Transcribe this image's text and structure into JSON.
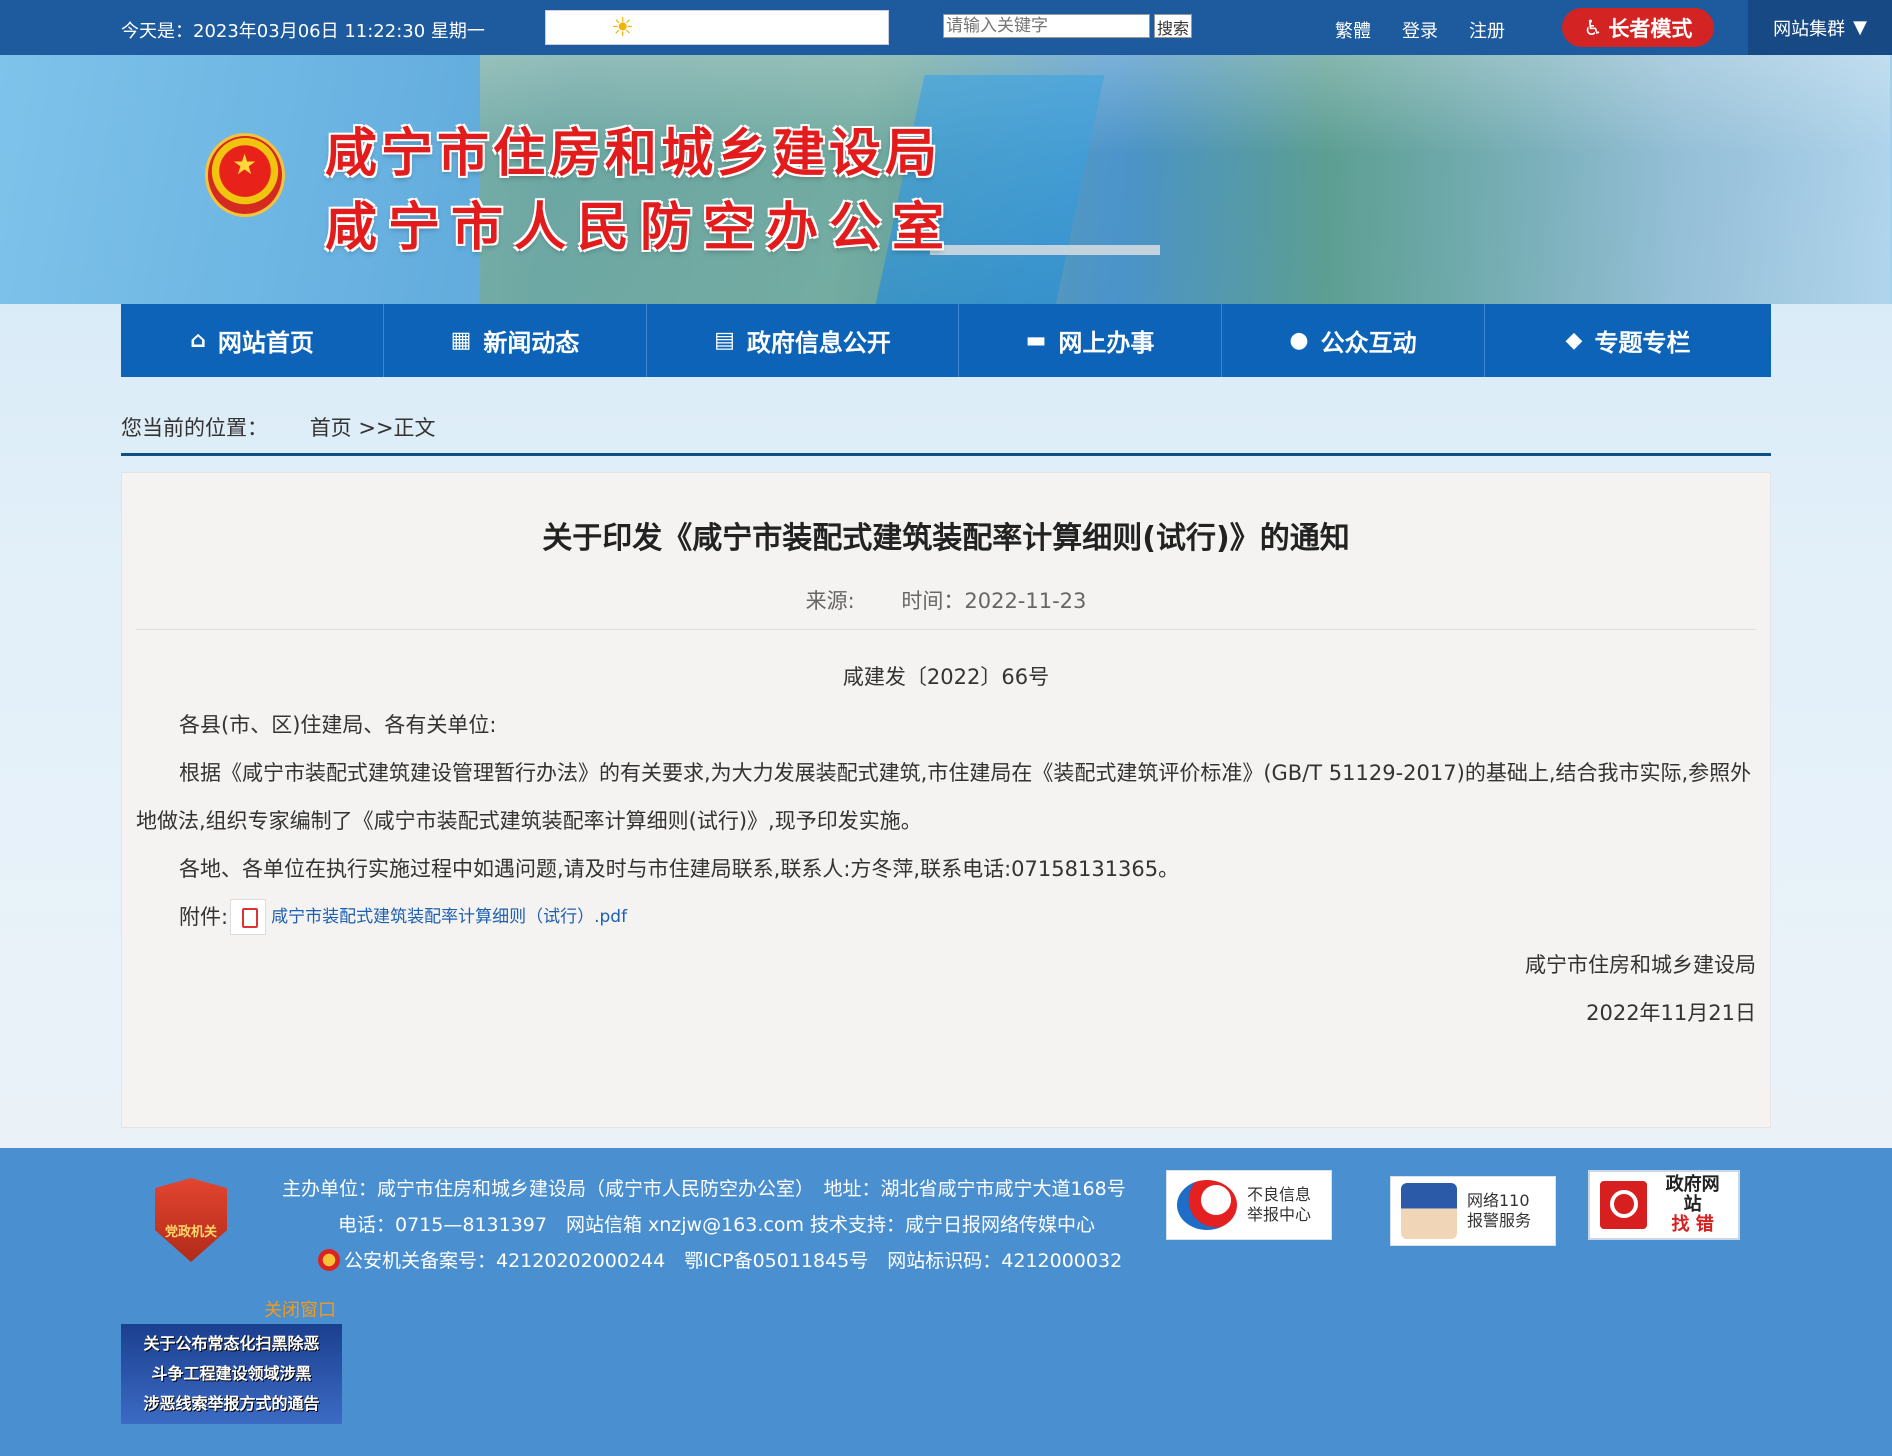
{
  "topbar": {
    "date_text": "今天是：2023年03月06日  11:22:30  星期一",
    "weather_icon": "sun-icon",
    "search_placeholder": "请输入关键字",
    "search_button": "搜索",
    "traditional": "繁體",
    "login": "登录",
    "register": "注册",
    "elder_mode": "长者模式",
    "site_group": "网站集群",
    "site_group_arrow": "▼"
  },
  "banner": {
    "line1": "咸宁市住房和城乡建设局",
    "line2": "咸宁市人民防空办公室"
  },
  "nav": {
    "items": [
      {
        "label": "网站首页",
        "icon": "home-icon",
        "glyph": "⌂"
      },
      {
        "label": "新闻动态",
        "icon": "grid-icon",
        "glyph": "▦"
      },
      {
        "label": "政府信息公开",
        "icon": "document-icon",
        "glyph": "▤"
      },
      {
        "label": "网上办事",
        "icon": "folder-icon",
        "glyph": "▬"
      },
      {
        "label": "公众互动",
        "icon": "chat-bubble-icon",
        "glyph": "●"
      },
      {
        "label": "专题专栏",
        "icon": "tag-icon",
        "glyph": "◆"
      }
    ]
  },
  "breadcrumb": {
    "label": "您当前的位置：",
    "path": "首页 >>正文"
  },
  "article": {
    "title": "关于印发《咸宁市装配式建筑装配率计算细则(试行)》的通知",
    "source_label": "来源:",
    "time_label": "时间：2022-11-23",
    "doc_no": "咸建发〔2022〕66号",
    "salutation": "各县(市、区)住建局、各有关单位:",
    "paragraph1": "根据《咸宁市装配式建筑建设管理暂行办法》的有关要求,为大力发展装配式建筑,市住建局在《装配式建筑评价标准》(GB/T 51129-2017)的基础上,结合我市实际,参照外地做法,组织专家编制了《咸宁市装配式建筑装配率计算细则(试行)》,现予印发实施。",
    "paragraph2": "各地、各单位在执行实施过程中如遇问题,请及时与市住建局联系,联系人:方冬萍,联系电话:07158131365。",
    "attachment_label": "附件:",
    "attachment_name": "咸宁市装配式建筑装配率计算细则（试行）.pdf",
    "signature": "咸宁市住房和城乡建设局",
    "sign_date": "2022年11月21日"
  },
  "footer": {
    "badge_text": "党政机关",
    "line1": "主办单位：咸宁市住房和城乡建设局（咸宁市人民防空办公室）　地址：湖北省咸宁市咸宁大道168号",
    "line2": "电话：0715—8131397　网站信箱 xnzjw@163.com 技术支持：咸宁日报网络传媒中心",
    "line3": "公安机关备案号：42120202000244　鄂ICP备05011845号　网站标识码：4212000032",
    "bad_info_line1": "不良信息",
    "bad_info_line2": "举报中心",
    "net110_line1": "网络110",
    "net110_line2": "报警服务",
    "gov_find_line1": "政府网站",
    "gov_find_line2": "找 错",
    "close_window": "关闭窗口",
    "ad_line1": "关于公布常态化扫黑除恶",
    "ad_line2": "斗争工程建设领域涉黑",
    "ad_line3": "涉恶线索举报方式的通告"
  }
}
